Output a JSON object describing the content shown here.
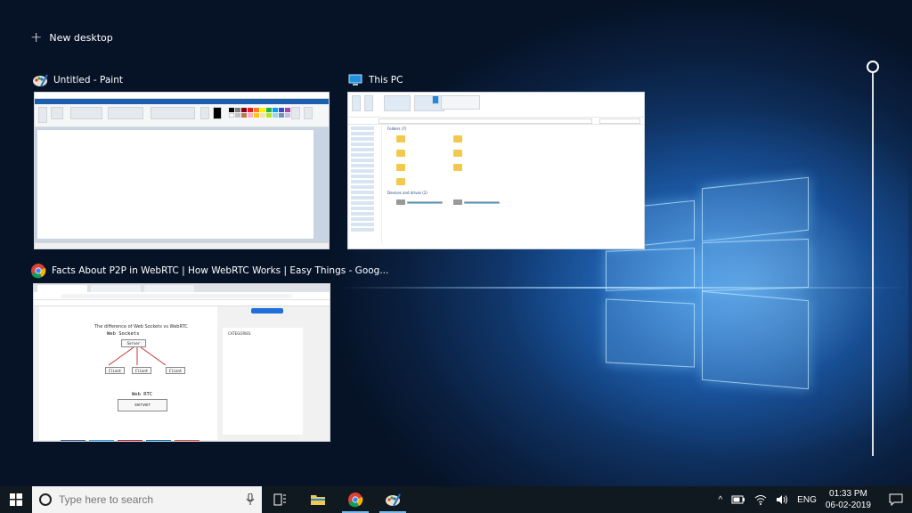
{
  "new_desktop_label": "New desktop",
  "windows": {
    "paint": {
      "title": "Untitled - Paint",
      "status_text": "100%"
    },
    "explorer": {
      "title": "This PC",
      "folders_header": "Folders (7)",
      "devices_header": "Devices and drives (2)"
    },
    "chrome": {
      "title": "Facts About P2P in WebRTC | How WebRTC Works | Easy Things - Goog...",
      "heading": "The difference of Web Sockets vs WebRTC",
      "diagram_title": "Web Sockets",
      "diagram_server": "Server",
      "diagram_client": "Client",
      "diagram2_title": "Web RTC",
      "diagram2_server": "server",
      "sidebar_heading": "CATEGORIES"
    }
  },
  "taskbar": {
    "search_placeholder": "Type here to search",
    "language": "ENG",
    "time": "01:33 PM",
    "date": "06-02-2019"
  },
  "colors": {
    "accent": "#76b9ed",
    "taskbar": "#101820"
  }
}
